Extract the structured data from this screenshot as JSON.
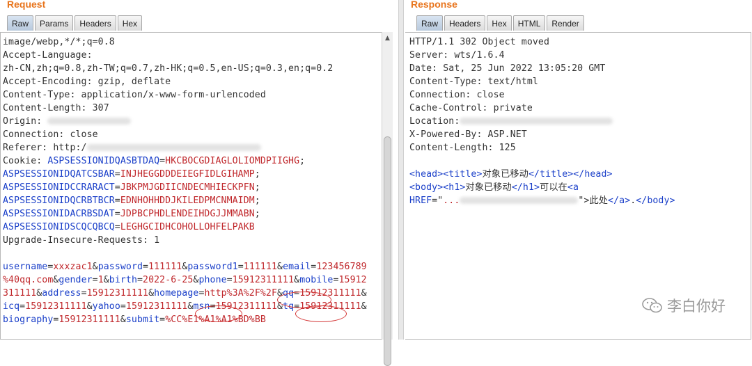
{
  "request": {
    "title": "Request",
    "tabs": [
      "Raw",
      "Params",
      "Headers",
      "Hex"
    ],
    "active_tab": "Raw",
    "lines": [
      {
        "t": "image/webp,*/*;q=0.8"
      },
      {
        "t": "Accept-Language:"
      },
      {
        "t": "zh-CN,zh;q=0.8,zh-TW;q=0.7,zh-HK;q=0.5,en-US;q=0.3,en;q=0.2"
      },
      {
        "t": "Accept-Encoding: gzip, deflate"
      },
      {
        "t": "Content-Type: application/x-www-form-urlencoded"
      },
      {
        "t": "Content-Length: 307"
      },
      {
        "t": "Origin: "
      },
      {
        "t": "Connection: close"
      },
      {
        "t": "Referer: http:/"
      },
      {
        "cookie_prefix": "Cookie: ",
        "k": "ASPSESSIONIDQASBTDAQ",
        "eq": "=",
        "v": "HKCBOCGDIAGLOLIOMDPIIGHG",
        "end": ";"
      },
      {
        "k": "ASPSESSIONIDQATCSBAR",
        "eq": "=",
        "v": "INJHEGGDDDEIEGFIDLGIHAMP",
        "end": ";"
      },
      {
        "k": "ASPSESSIONIDCCRARACT",
        "eq": "=",
        "v": "JBKPMJGDIICNDECMHIECKPFN",
        "end": ";"
      },
      {
        "k": "ASPSESSIONIDQCRBTBCR",
        "eq": "=",
        "v": "EDNHOHHDDJKILEDPMCNMAIDM",
        "end": ";"
      },
      {
        "k": "ASPSESSIONIDACRBSDAT",
        "eq": "=",
        "v": "JDPBCPHDLENDEIHDGJJMMABN",
        "end": ";"
      },
      {
        "k": "ASPSESSIONIDSCQCQBCQ",
        "eq": "=",
        "v": "LEGHGCIDHCOHOLLOHFELPAKB",
        "end": ""
      },
      {
        "t": "Upgrade-Insecure-Requests: 1"
      }
    ],
    "body_lines": [
      [
        [
          "k",
          "username"
        ],
        [
          "t",
          "="
        ],
        [
          "v",
          "xxxzac1"
        ],
        [
          "t",
          "&"
        ],
        [
          "k",
          "password"
        ],
        [
          "t",
          "="
        ],
        [
          "v",
          "111111"
        ],
        [
          "t",
          "&"
        ],
        [
          "k",
          "password1"
        ],
        [
          "t",
          "="
        ],
        [
          "v",
          "111111"
        ],
        [
          "t",
          "&"
        ],
        [
          "k",
          "email"
        ],
        [
          "t",
          "="
        ],
        [
          "v",
          "123456789"
        ]
      ],
      [
        [
          "v",
          "%40qq.com"
        ],
        [
          "t",
          "&"
        ],
        [
          "k",
          "gender"
        ],
        [
          "t",
          "="
        ],
        [
          "v",
          "1"
        ],
        [
          "t",
          "&"
        ],
        [
          "k",
          "birth"
        ],
        [
          "t",
          "="
        ],
        [
          "v",
          "2022-6-25"
        ],
        [
          "t",
          "&"
        ],
        [
          "k",
          "phone"
        ],
        [
          "t",
          "="
        ],
        [
          "v",
          "15912311111"
        ],
        [
          "t",
          "&"
        ],
        [
          "k",
          "mobile"
        ],
        [
          "t",
          "="
        ],
        [
          "v",
          "15912"
        ]
      ],
      [
        [
          "v",
          "311111"
        ],
        [
          "t",
          "&"
        ],
        [
          "k",
          "address"
        ],
        [
          "t",
          "="
        ],
        [
          "v",
          "15912311111"
        ],
        [
          "t",
          "&"
        ],
        [
          "k",
          "homepage"
        ],
        [
          "t",
          "="
        ],
        [
          "v",
          "http%3A%2F%2F"
        ],
        [
          "t",
          "&"
        ],
        [
          "k",
          "qq"
        ],
        [
          "t",
          "="
        ],
        [
          "v",
          "15912311111"
        ],
        [
          "t",
          "&"
        ]
      ],
      [
        [
          "k",
          "icq"
        ],
        [
          "t",
          "="
        ],
        [
          "v",
          "15912311111"
        ],
        [
          "t",
          "&"
        ],
        [
          "k",
          "yahoo"
        ],
        [
          "t",
          "="
        ],
        [
          "v",
          "15912311111"
        ],
        [
          "t",
          "&"
        ],
        [
          "k",
          "msn"
        ],
        [
          "t",
          "="
        ],
        [
          "v",
          "15912311111"
        ],
        [
          "t",
          "&"
        ],
        [
          "k",
          "tq"
        ],
        [
          "t",
          "="
        ],
        [
          "v",
          "15912311111"
        ],
        [
          "t",
          "&"
        ]
      ],
      [
        [
          "k",
          "biography"
        ],
        [
          "t",
          "="
        ],
        [
          "v",
          "15912311111"
        ],
        [
          "t",
          "&"
        ],
        [
          "k",
          "submit"
        ],
        [
          "t",
          "="
        ],
        [
          "v",
          "%CC%E1%A1%A1%BD%BB"
        ]
      ]
    ]
  },
  "response": {
    "title": "Response",
    "tabs": [
      "Raw",
      "Headers",
      "Hex",
      "HTML",
      "Render"
    ],
    "active_tab": "Raw",
    "lines": [
      "HTTP/1.1 302 Object moved",
      "Server: wts/1.6.4",
      "Date: Sat, 25 Jun 2022 13:05:20 GMT",
      "Content-Type: text/html",
      "Connection: close",
      "Cache-Control: private",
      "Location:",
      "X-Powered-By: ASP.NET",
      "Content-Length: 125"
    ],
    "body_lines": [
      [
        [
          "k",
          "<head><title>"
        ],
        [
          "t",
          "对象已移动"
        ],
        [
          "k",
          "</title></head>"
        ]
      ],
      [
        [
          "k",
          "<body><h1>"
        ],
        [
          "t",
          "对象已移动"
        ],
        [
          "k",
          "</h1>"
        ],
        [
          "t",
          "可以在"
        ],
        [
          "k",
          "<a"
        ]
      ],
      [
        [
          "k",
          "HREF"
        ],
        [
          "t",
          "=\""
        ],
        [
          "v",
          "..."
        ],
        [
          "t",
          "\">此处"
        ],
        [
          "k",
          "</a>"
        ],
        [
          "t",
          "."
        ],
        [
          "k",
          "</body>"
        ]
      ]
    ]
  },
  "watermark": {
    "text": "李白你好",
    "icon": "wechat-icon"
  },
  "colors": {
    "title": "#e8741c",
    "key": "#1a3fc9",
    "value": "#c0282c",
    "text": "#333333"
  }
}
